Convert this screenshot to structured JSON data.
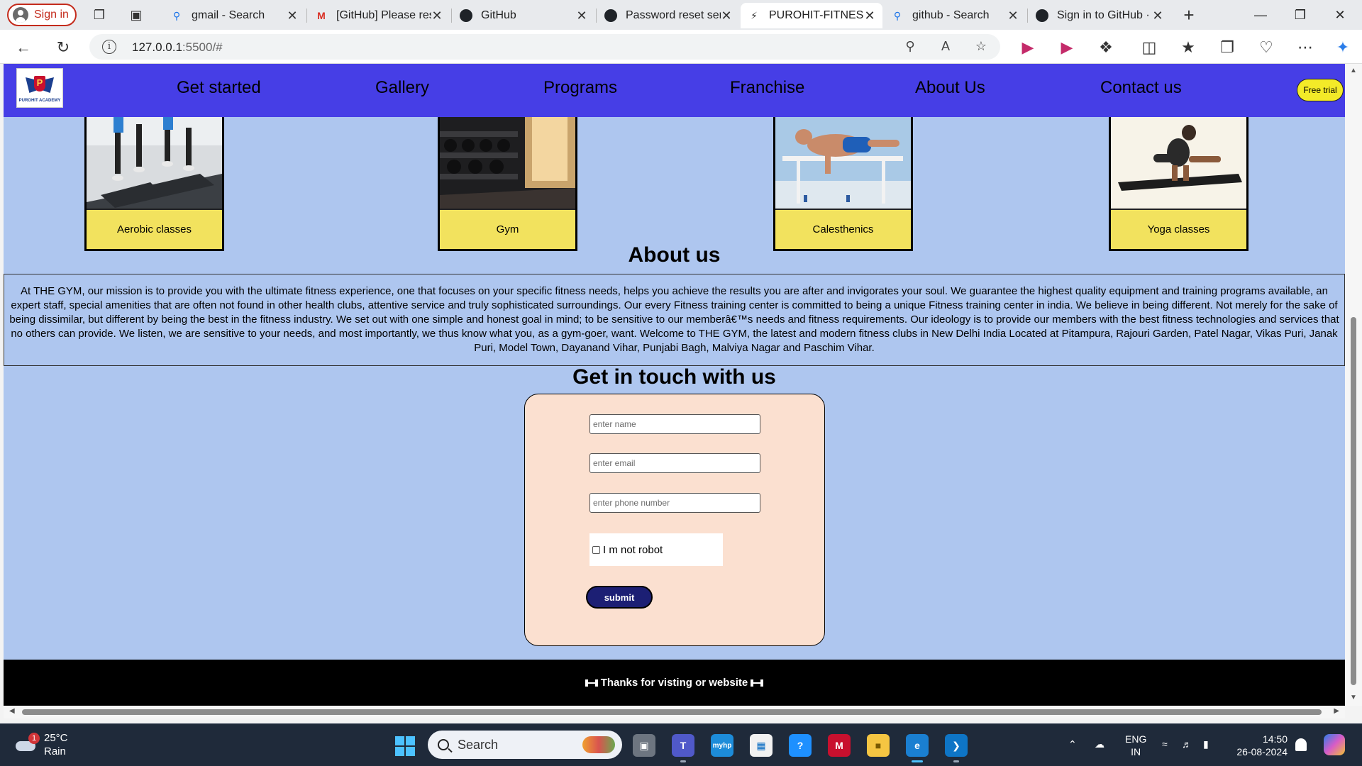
{
  "browser": {
    "signin_label": "Sign in",
    "tabs": [
      {
        "title": "gmail - Search",
        "icon": "search-icon"
      },
      {
        "title": "[GitHub] Please res",
        "icon": "gmail-icon"
      },
      {
        "title": "GitHub",
        "icon": "github-icon"
      },
      {
        "title": "Password reset sen",
        "icon": "github-icon"
      },
      {
        "title": "PUROHIT-FITNESS",
        "icon": "site-icon",
        "active": true
      },
      {
        "title": "github - Search",
        "icon": "search-icon"
      },
      {
        "title": "Sign in to GitHub ·",
        "icon": "github-icon"
      }
    ],
    "new_tab_label": "+",
    "url_host": "127.0.0.1",
    "url_rest": ":5500/#"
  },
  "site": {
    "logo_text": "PUROHIT ACADEMY",
    "logo_letter": "P",
    "nav": [
      "Get started",
      "Gallery",
      "Programs",
      "Franchise",
      "About Us",
      "Contact us"
    ],
    "free_trial_label": "Free trial",
    "programs": [
      {
        "label": "Aerobic classes"
      },
      {
        "label": "Gym"
      },
      {
        "label": "Calesthenics"
      },
      {
        "label": "Yoga classes"
      }
    ],
    "about_title": "About us",
    "about_text": "At THE GYM, our mission is to provide you with the ultimate fitness experience, one that focuses on your specific fitness needs, helps you achieve the results you are after and invigorates your soul. We guarantee the highest quality equipment and training programs available, an expert staff, special amenities that are often not found in other health clubs, attentive service and truly sophisticated surroundings. Our every Fitness training center is committed to being a unique Fitness training center in india. We believe in being different. Not merely for the sake of being dissimilar, but different by being the best in the fitness industry. We set out with one simple and honest goal in mind; to be sensitive to our memberâ€™s needs and fitness requirements. Our ideology is to provide our members with the best fitness technologies and services that no others can provide. We listen, we are sensitive to your needs, and most importantly, we thus know what you, as a gym-goer, want. Welcome to THE GYM, the latest and modern fitness clubs in New Delhi India Located at Pitampura, Rajouri Garden, Patel Nagar, Vikas Puri, Janak Puri, Model Town, Dayanand Vihar, Punjabi Bagh, Malviya Nagar and Paschim Vihar.",
    "contact_title": "Get in touch with us",
    "form": {
      "name_placeholder": "enter name",
      "email_placeholder": "enter email",
      "phone_placeholder": "enter phone number",
      "robot_label": "I m not robot",
      "submit_label": "submit"
    },
    "footer_text": "Thanks for visting or website"
  },
  "taskbar": {
    "weather_temp": "25°C",
    "weather_desc": "Rain",
    "weather_badge": "1",
    "search_label": "Search",
    "lang_top": "ENG",
    "lang_bottom": "IN",
    "time": "14:50",
    "date": "26-08-2024"
  },
  "colors": {
    "navbar": "#463ee6",
    "page_bg": "#aec6ef",
    "card_label": "#f2e25e",
    "form_bg": "#fbe0d0",
    "submit": "#1c1f74",
    "free_trial": "#f3ea28"
  }
}
